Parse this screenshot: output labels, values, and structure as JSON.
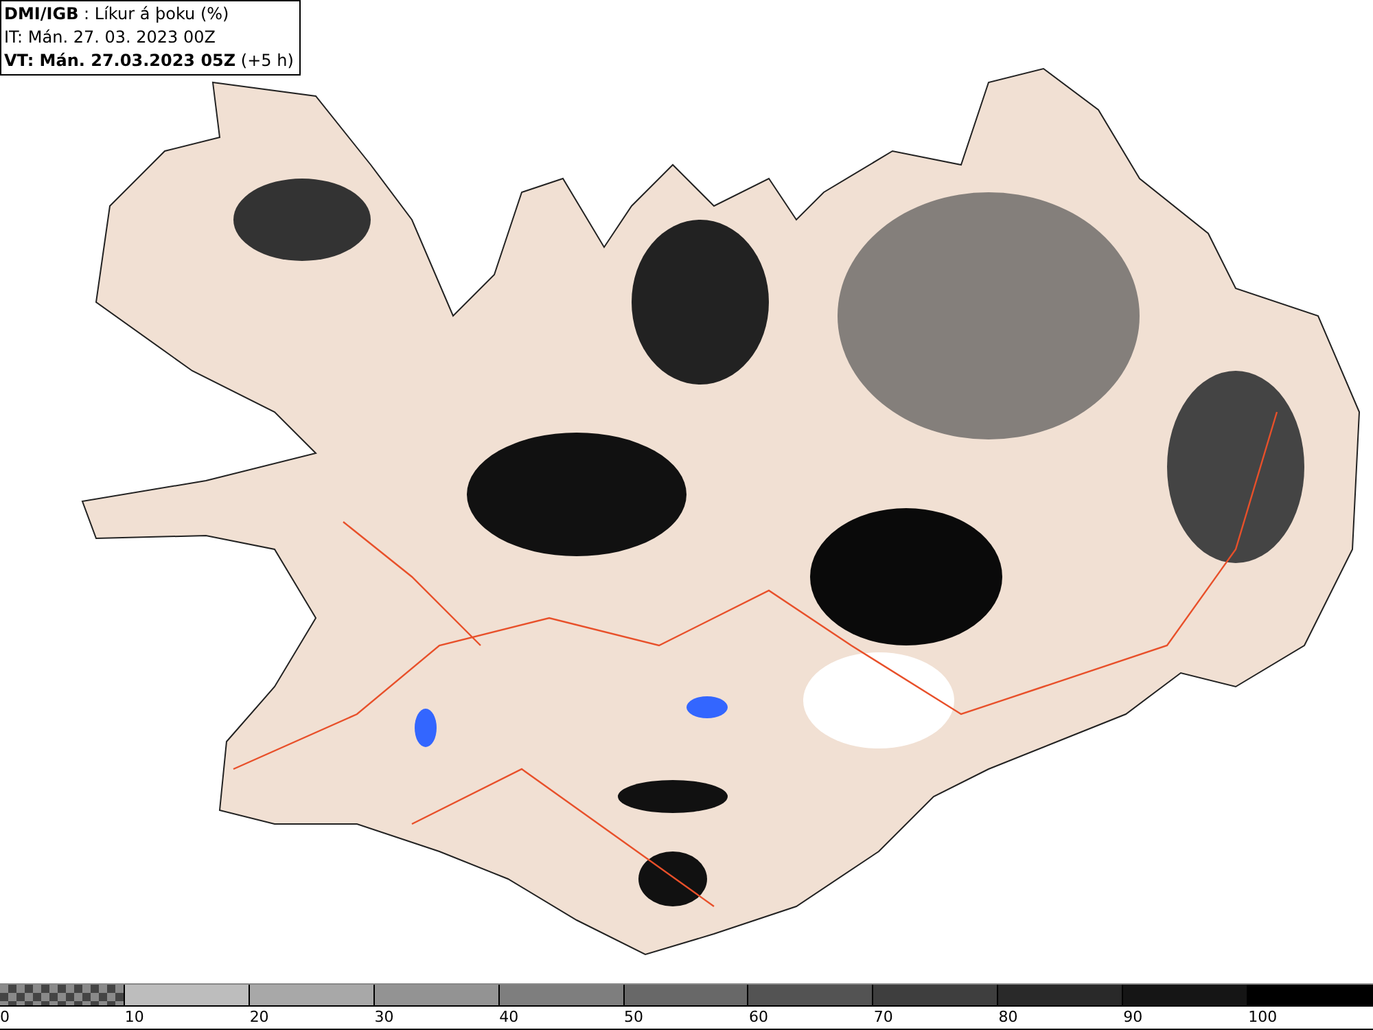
{
  "header": {
    "lines": [
      "**DMI/IGB** : Líkur á þoku (%)",
      "IT: Mán. 27. 03. 2023 00Z",
      "**VT: Mán. 27.03.2023 05Z** (+5 h)"
    ]
  },
  "legend": {
    "segments": [
      {
        "kind": "checkered"
      },
      {
        "kind": "solid",
        "color": "#bdbdbd"
      },
      {
        "kind": "solid",
        "color": "#a8a8a8"
      },
      {
        "kind": "solid",
        "color": "#939393"
      },
      {
        "kind": "solid",
        "color": "#7e7e7e"
      },
      {
        "kind": "solid",
        "color": "#686868"
      },
      {
        "kind": "solid",
        "color": "#535353"
      },
      {
        "kind": "solid",
        "color": "#3e3e3e"
      },
      {
        "kind": "solid",
        "color": "#292929"
      },
      {
        "kind": "solid",
        "color": "#151515"
      },
      {
        "kind": "solid",
        "color": "#000000"
      }
    ],
    "labels": [
      "0",
      "10",
      "20",
      "30",
      "40",
      "50",
      "60",
      "70",
      "80",
      "90",
      "100"
    ]
  }
}
